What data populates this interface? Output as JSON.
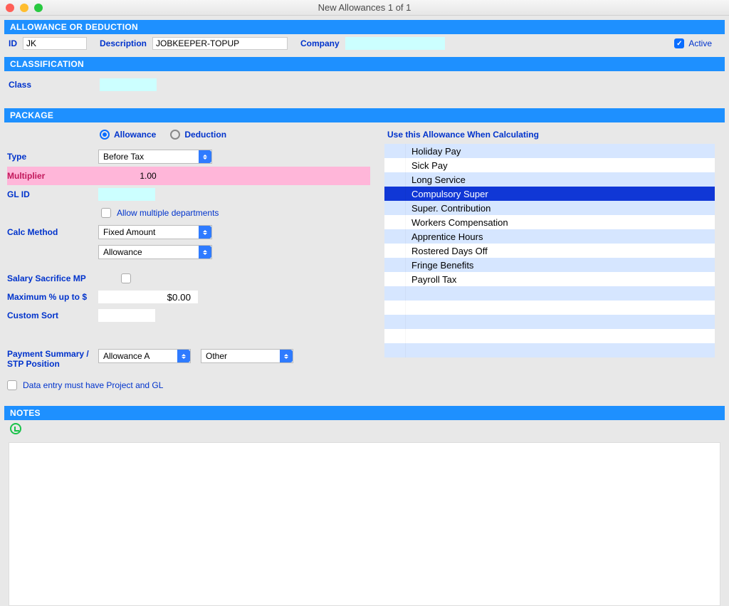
{
  "window": {
    "title": "New Allowances  1  of  1"
  },
  "sections": {
    "allowance_or_deduction": "ALLOWANCE OR DEDUCTION",
    "classification": "CLASSIFICATION",
    "package": "PACKAGE",
    "notes": "NOTES"
  },
  "header": {
    "id_label": "ID",
    "id_value": "JK",
    "description_label": "Description",
    "description_value": "JOBKEEPER-TOPUP",
    "company_label": "Company",
    "company_value": "",
    "active_label": "Active",
    "active_checked": true
  },
  "classification": {
    "class_label": "Class",
    "class_value": ""
  },
  "package": {
    "radio_allowance": "Allowance",
    "radio_deduction": "Deduction",
    "radio_selected": "allowance",
    "type_label": "Type",
    "type_value": "Before Tax",
    "multiplier_label": "Multiplier",
    "multiplier_value": "1.00",
    "gl_id_label": "GL ID",
    "gl_id_value": "",
    "allow_multi_dept_label": "Allow multiple departments",
    "allow_multi_dept_checked": false,
    "calc_method_label": "Calc Method",
    "calc_method_value": "Fixed Amount",
    "calc_subtype_value": "Allowance",
    "salary_sacrifice_label": "Salary Sacrifice MP",
    "salary_sacrifice_checked": false,
    "max_pct_label": "Maximum % up to $",
    "max_pct_value": "$0.00",
    "custom_sort_label": "Custom Sort",
    "custom_sort_value": "",
    "payment_summary_label": "Payment Summary / STP Position",
    "payment_summary_value": "Allowance A",
    "payment_summary_value2": "Other",
    "data_entry_label": "Data entry must have Project and GL",
    "data_entry_checked": false,
    "right_title": "Use this Allowance When Calculating",
    "calc_items": [
      {
        "label": "Holiday Pay",
        "selected": false
      },
      {
        "label": "Sick Pay",
        "selected": false
      },
      {
        "label": "Long Service",
        "selected": false
      },
      {
        "label": "Compulsory Super",
        "selected": true
      },
      {
        "label": "Super. Contribution",
        "selected": false
      },
      {
        "label": "Workers Compensation",
        "selected": false
      },
      {
        "label": "Apprentice Hours",
        "selected": false
      },
      {
        "label": "Rostered Days Off",
        "selected": false
      },
      {
        "label": "Fringe Benefits",
        "selected": false
      },
      {
        "label": "Payroll Tax",
        "selected": false
      },
      {
        "label": "",
        "selected": false
      },
      {
        "label": "",
        "selected": false
      },
      {
        "label": "",
        "selected": false
      },
      {
        "label": "",
        "selected": false
      },
      {
        "label": "",
        "selected": false
      }
    ]
  }
}
